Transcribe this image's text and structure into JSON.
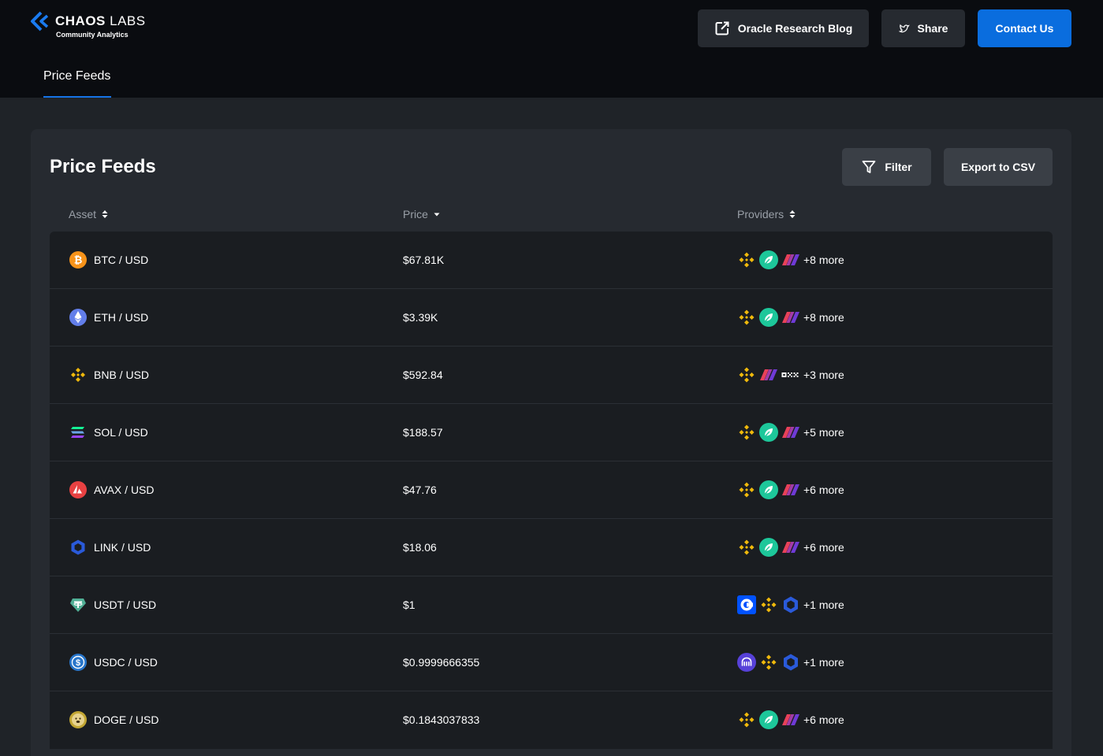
{
  "header": {
    "logo_title_bold": "CHAOS",
    "logo_title_light": "LABS",
    "logo_subtitle": "Community Analytics",
    "blog_label": "Oracle Research Blog",
    "share_label": "Share",
    "contact_label": "Contact Us"
  },
  "nav": {
    "tab_label": "Price Feeds"
  },
  "card": {
    "title": "Price Feeds",
    "filter_label": "Filter",
    "export_label": "Export to CSV"
  },
  "table": {
    "columns": [
      "Asset",
      "Price",
      "Providers"
    ],
    "rows": [
      {
        "asset": "BTC / USD",
        "icon": "btc-icon",
        "price": "$67.81K",
        "providers": [
          "binance",
          "leaf",
          "stripes"
        ],
        "more": "+8 more"
      },
      {
        "asset": "ETH / USD",
        "icon": "eth-icon",
        "price": "$3.39K",
        "providers": [
          "binance",
          "leaf",
          "stripes"
        ],
        "more": "+8 more"
      },
      {
        "asset": "BNB / USD",
        "icon": "bnb-icon",
        "price": "$592.84",
        "providers": [
          "binance",
          "stripes",
          "okx"
        ],
        "more": "+3 more"
      },
      {
        "asset": "SOL / USD",
        "icon": "sol-icon",
        "price": "$188.57",
        "providers": [
          "binance",
          "leaf",
          "stripes"
        ],
        "more": "+5 more"
      },
      {
        "asset": "AVAX / USD",
        "icon": "avax-icon",
        "price": "$47.76",
        "providers": [
          "binance",
          "leaf",
          "stripes"
        ],
        "more": "+6 more"
      },
      {
        "asset": "LINK / USD",
        "icon": "link-icon",
        "price": "$18.06",
        "providers": [
          "binance",
          "leaf",
          "stripes"
        ],
        "more": "+6 more"
      },
      {
        "asset": "USDT / USD",
        "icon": "usdt-icon",
        "price": "$1",
        "providers": [
          "coinbase",
          "binance",
          "chainlink"
        ],
        "more": "+1 more"
      },
      {
        "asset": "USDC / USD",
        "icon": "usdc-icon",
        "price": "$0.9999666355",
        "providers": [
          "kraken",
          "binance",
          "chainlink"
        ],
        "more": "+1 more"
      },
      {
        "asset": "DOGE / USD",
        "icon": "doge-icon",
        "price": "$0.1843037833",
        "providers": [
          "binance",
          "leaf",
          "stripes"
        ],
        "more": "+6 more"
      }
    ]
  },
  "colors": {
    "accent": "#0a6dde",
    "background": "#1f2328",
    "header": "#0a0c10",
    "binance": "#f0b90b"
  }
}
